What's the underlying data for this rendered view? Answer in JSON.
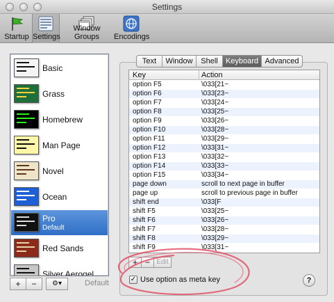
{
  "window": {
    "title": "Settings"
  },
  "toolbar": {
    "items": [
      {
        "label": "Startup",
        "icon": "flag-icon"
      },
      {
        "label": "Settings",
        "icon": "settings-icon",
        "active": true
      },
      {
        "label": "Window Groups",
        "icon": "window-groups-icon"
      },
      {
        "label": "Encodings",
        "icon": "globe-icon"
      }
    ]
  },
  "profiles": [
    {
      "name": "Basic",
      "thumb_bg": "#f4f4f4",
      "text_color": "#111111"
    },
    {
      "name": "Grass",
      "thumb_bg": "#1f6f3a",
      "text_color": "#ffd23f"
    },
    {
      "name": "Homebrew",
      "thumb_bg": "#000000",
      "text_color": "#29f51a"
    },
    {
      "name": "Man Page",
      "thumb_bg": "#fff7a8",
      "text_color": "#111111"
    },
    {
      "name": "Novel",
      "thumb_bg": "#efe4c8",
      "text_color": "#5a3a1a"
    },
    {
      "name": "Ocean",
      "thumb_bg": "#1f5fd6",
      "text_color": "#ffffff"
    },
    {
      "name": "Pro",
      "subtitle": "Default",
      "thumb_bg": "#111111",
      "text_color": "#dddddd",
      "selected": true
    },
    {
      "name": "Red Sands",
      "thumb_bg": "#8c2a1c",
      "text_color": "#e8d6a8"
    },
    {
      "name": "Silver Aerogel",
      "thumb_bg": "#c7c7c7",
      "text_color": "#111111"
    }
  ],
  "list_buttons": {
    "add": "+",
    "remove": "−",
    "gear": "⚙▾",
    "default": "Default"
  },
  "tabs": [
    {
      "label": "Text"
    },
    {
      "label": "Window"
    },
    {
      "label": "Shell"
    },
    {
      "label": "Keyboard",
      "active": true
    },
    {
      "label": "Advanced"
    }
  ],
  "keyboard_table": {
    "columns": {
      "key": "Key",
      "action": "Action"
    },
    "rows": [
      {
        "key": "option F5",
        "action": "\\033[21~"
      },
      {
        "key": "option F6",
        "action": "\\033[23~"
      },
      {
        "key": "option F7",
        "action": "\\033[24~"
      },
      {
        "key": "option F8",
        "action": "\\033[25~"
      },
      {
        "key": "option F9",
        "action": "\\033[26~"
      },
      {
        "key": "option F10",
        "action": "\\033[28~"
      },
      {
        "key": "option F11",
        "action": "\\033[29~"
      },
      {
        "key": "option F12",
        "action": "\\033[31~"
      },
      {
        "key": "option F13",
        "action": "\\033[32~"
      },
      {
        "key": "option F14",
        "action": "\\033[33~"
      },
      {
        "key": "option F15",
        "action": "\\033[34~"
      },
      {
        "key": "page down",
        "action": "scroll to next page in buffer"
      },
      {
        "key": "page up",
        "action": "scroll to previous page in buffer"
      },
      {
        "key": "shift end",
        "action": "\\033[F"
      },
      {
        "key": "shift F5",
        "action": "\\033[25~"
      },
      {
        "key": "shift F6",
        "action": "\\033[26~"
      },
      {
        "key": "shift F7",
        "action": "\\033[28~"
      },
      {
        "key": "shift F8",
        "action": "\\033[29~"
      },
      {
        "key": "shift F9",
        "action": "\\033[31~"
      }
    ]
  },
  "keyboard_buttons": {
    "add": "+",
    "remove": "−",
    "edit": "Edit"
  },
  "meta_option": {
    "label": "Use option as meta key",
    "checked": true,
    "check_mark": "✓"
  },
  "help": {
    "label": "?"
  },
  "colors": {
    "selection": "#3b78d0",
    "annotation": "#e0546a"
  }
}
